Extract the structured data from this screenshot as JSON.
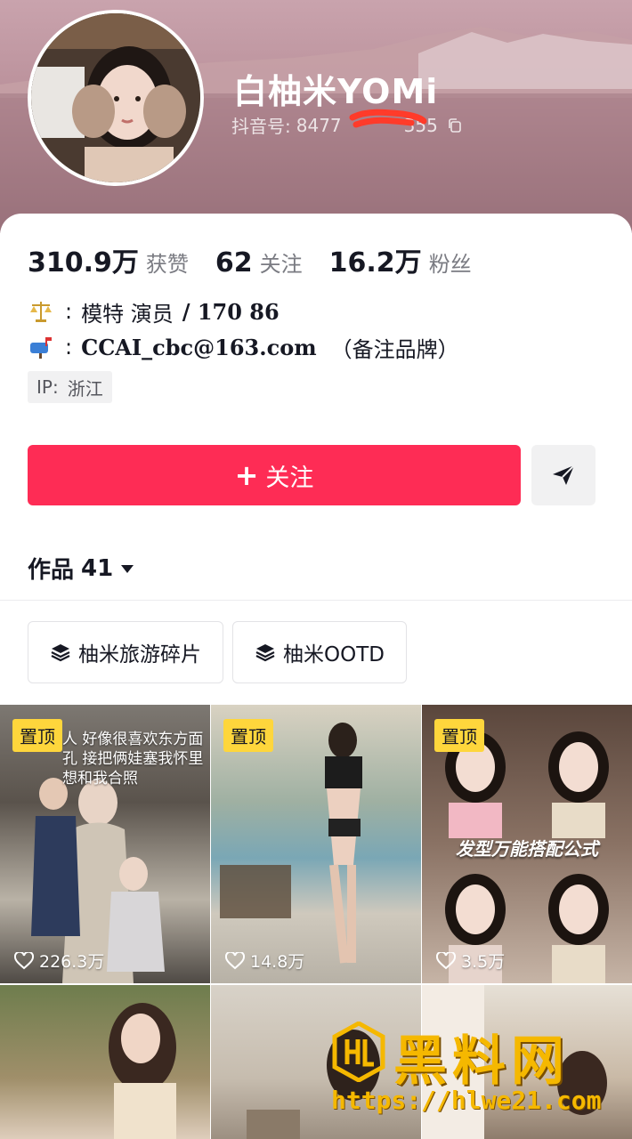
{
  "profile": {
    "nickname": "白柚米YOMi",
    "douyin_id_label": "抖音号:",
    "douyin_id_prefix": "8477",
    "douyin_id_suffix": "355"
  },
  "stats": [
    {
      "value": "310.9万",
      "label": "获赞"
    },
    {
      "value": "62",
      "label": "关注"
    },
    {
      "value": "16.2万",
      "label": "粉丝"
    }
  ],
  "bio": {
    "line1_colon": ":",
    "line1_job": "模特 演员",
    "line1_rest": "/ 170  86",
    "line2_colon": ":",
    "line2_email": "CCAI_cbc@163.com",
    "line2_note": "（备注品牌）"
  },
  "ip": {
    "label": "IP:",
    "value": "浙江"
  },
  "actions": {
    "follow_label": "关注",
    "follow_plus": "+"
  },
  "works": {
    "label": "作品",
    "count": "41"
  },
  "collections": [
    {
      "label": "柚米旅游碎片"
    },
    {
      "label": "柚米OOTD"
    }
  ],
  "videos": [
    {
      "pinned": "置顶",
      "likes": "226.3万",
      "overlay": "人 好像很喜欢东方面孔 接把俩娃塞我怀里 想和我合照"
    },
    {
      "pinned": "置顶",
      "likes": "14.8万"
    },
    {
      "pinned": "置顶",
      "likes": "3.5万",
      "caption": "发型万能搭配公式"
    },
    {},
    {},
    {}
  ],
  "watermark": {
    "brand": "黑料网",
    "url": "https://hlwe21.com"
  },
  "colors": {
    "accent": "#fe2c55",
    "pin": "#fed63c",
    "watermark": "#f5b800"
  }
}
